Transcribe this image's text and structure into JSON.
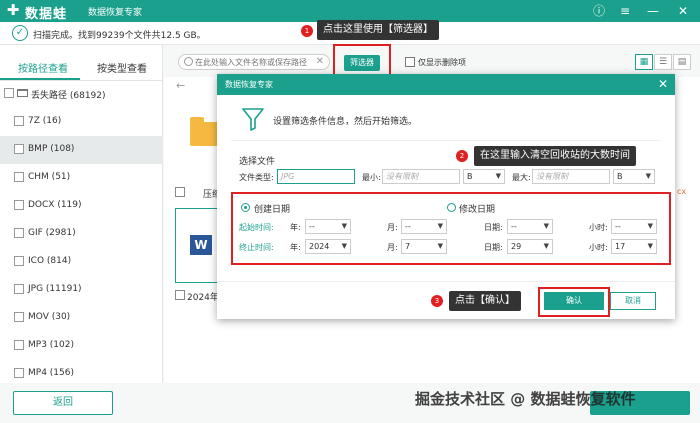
{
  "app": {
    "logo_text": "数据蛙",
    "title": "数据恢复专家"
  },
  "status": {
    "text": "扫描完成。找到99239个文件共12.5 GB。"
  },
  "tabs": {
    "by_path": "按路径查看",
    "by_type": "按类型查看"
  },
  "sidebar": {
    "lost_path": "丢失路径 (68192)",
    "items": [
      {
        "label": "7Z (16)"
      },
      {
        "label": "BMP (108)"
      },
      {
        "label": "CHM (51)"
      },
      {
        "label": "DOCX (119)"
      },
      {
        "label": "GIF (2981)"
      },
      {
        "label": "ICO (814)"
      },
      {
        "label": "JPG (11191)"
      },
      {
        "label": "MOV (30)"
      },
      {
        "label": "MP3 (102)"
      },
      {
        "label": "MP4 (156)"
      }
    ]
  },
  "back_button": "返回",
  "toolbar": {
    "search_placeholder": "在此处输入文件名称或保存路径",
    "filter_button": "筛选器",
    "show_deleted_only": "仅显示删除项"
  },
  "file_list": {
    "row1_name": "压缩",
    "row2_name": "2024年...",
    "cx_fragment": "cx",
    "word_icon": "W"
  },
  "callouts": {
    "c1_num": "1",
    "c1_text": "点击这里使用【筛选器】",
    "c2_num": "2",
    "c2_text": "在这里输入清空回收站的大数时间",
    "c3_num": "3",
    "c3_text": "点击【确认】"
  },
  "dialog": {
    "title": "数据恢复专家",
    "instruction": "设置筛选条件信息，然后开始筛选。",
    "select_file": "选择文件",
    "file_type_label": "文件类型:",
    "file_type_placeholder": "JPG",
    "min_label": "最小:",
    "min_placeholder": "没有限制",
    "min_unit": "B",
    "max_label": "最大:",
    "max_placeholder": "没有限制",
    "max_unit": "B",
    "created_date": "创建日期",
    "modified_date": "修改日期",
    "start_time_label": "起始时间:",
    "end_time_label": "终止时间:",
    "year_label": "年:",
    "month_label": "月:",
    "day_label": "日期:",
    "hour_label": "小时:",
    "start": {
      "year": "--",
      "month": "--",
      "day": "--",
      "hour": "--"
    },
    "end": {
      "year": "2024",
      "month": "7",
      "day": "29",
      "hour": "17"
    },
    "confirm": "确认",
    "cancel": "取消"
  },
  "watermark": "掘金技术社区 @ 数据蛙恢复软件"
}
